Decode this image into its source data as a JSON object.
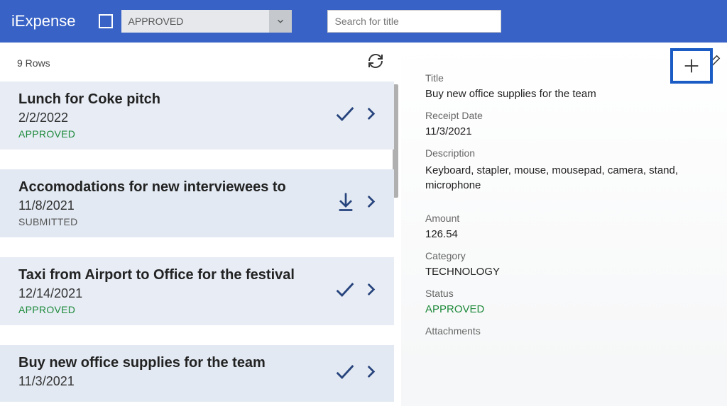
{
  "app": {
    "title": "iExpense"
  },
  "header": {
    "filter_dropdown": {
      "value": "APPROVED"
    },
    "search": {
      "placeholder": "Search for title"
    }
  },
  "list": {
    "row_count_label": "9 Rows",
    "items": [
      {
        "title": "Lunch for Coke pitch",
        "date": "2/2/2022",
        "status": "APPROVED",
        "status_class": "approved",
        "action": "check"
      },
      {
        "title": "Accomodations for new interviewees to",
        "date": "11/8/2021",
        "status": "SUBMITTED",
        "status_class": "submitted",
        "action": "download"
      },
      {
        "title": "Taxi from Airport to Office for the festival",
        "date": "12/14/2021",
        "status": "APPROVED",
        "status_class": "approved",
        "action": "check"
      },
      {
        "title": "Buy new office supplies for the team",
        "date": "11/3/2021",
        "status": "",
        "status_class": "approved",
        "action": "check"
      }
    ]
  },
  "detail": {
    "labels": {
      "title": "Title",
      "receipt_date": "Receipt Date",
      "description": "Description",
      "amount": "Amount",
      "category": "Category",
      "status": "Status",
      "attachments": "Attachments"
    },
    "title": "Buy new office supplies for the team",
    "receipt_date": "11/3/2021",
    "description": "Keyboard, stapler, mouse, mousepad, camera, stand, microphone",
    "amount": "126.54",
    "category": "TECHNOLOGY",
    "status": "APPROVED"
  }
}
